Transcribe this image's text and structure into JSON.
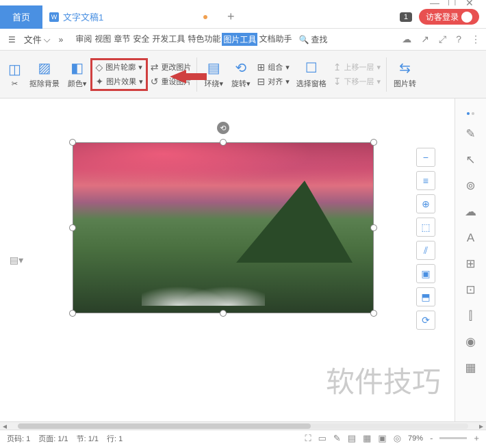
{
  "window": {
    "minimize": "—",
    "maximize": "☐",
    "close": "✕"
  },
  "tabs": {
    "home": "首页",
    "doc_icon": "W",
    "doc_name": "文字文稿1",
    "add": "+",
    "badge": "1",
    "login": "访客登录"
  },
  "menu": {
    "hamburger": "☰",
    "file": "文件",
    "arrows": "»",
    "items": [
      "审阅",
      "视图",
      "章节",
      "安全",
      "开发工具",
      "特色功能",
      "图片工具",
      "文档助手"
    ],
    "search": "查找",
    "right_icons": [
      "☁",
      "↗",
      "⤢",
      "?",
      "⋮"
    ]
  },
  "ribbon": {
    "crop": "✂",
    "remove_bg": "抠除背景",
    "color": "颜色",
    "outline": "图片轮廓",
    "effects": "图片效果",
    "change": "更改图片",
    "reset": "重设图片",
    "wrap": "环绕",
    "rotate": "旋转",
    "group": "组合",
    "align": "对齐",
    "select_pane": "选择窗格",
    "move_up": "上移一层",
    "move_down": "下移一层",
    "convert": "图片转"
  },
  "float_tools": [
    "−",
    "≡",
    "⊕",
    "⬚",
    "⫽",
    "▣",
    "⬒",
    "⟳"
  ],
  "right_tools": [
    "✎",
    "↖",
    "⊚",
    "☁",
    "A",
    "⊞",
    "⊡",
    "⫿",
    "◉",
    "▦"
  ],
  "watermark": "软件技巧",
  "status": {
    "page_code": "页码: 1",
    "page": "页面: 1/1",
    "section": "节: 1/1",
    "line": "行: 1",
    "view_icons": [
      "⛶",
      "▭",
      "✎",
      "▤",
      "▦",
      "▣",
      "◎"
    ],
    "zoom": "79%",
    "zoom_out": "-",
    "zoom_in": "+"
  }
}
